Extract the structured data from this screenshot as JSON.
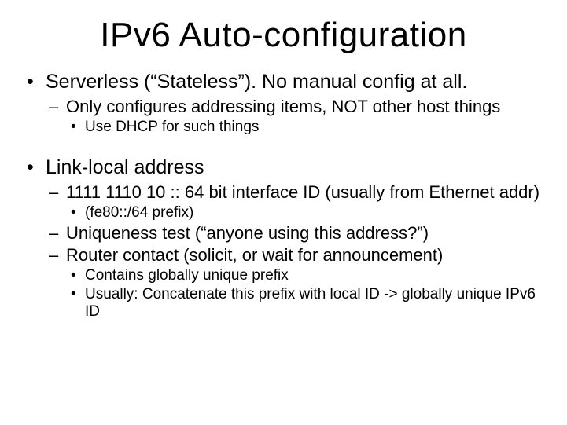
{
  "title": "IPv6 Auto-configuration",
  "bullets": [
    {
      "text": "Serverless (“Stateless”).  No manual config at all.",
      "sub": [
        {
          "text": "Only configures addressing items, NOT other host things",
          "sub": [
            {
              "text": "Use DHCP for such things"
            }
          ]
        }
      ]
    },
    {
      "text": "Link-local address",
      "sub": [
        {
          "text": "1111 1110 10  :: 64 bit interface ID  (usually from Ethernet addr)",
          "sub": [
            {
              "text": "(fe80::/64 prefix)"
            }
          ]
        },
        {
          "text": "Uniqueness test (“anyone using this address?”)"
        },
        {
          "text": "Router contact (solicit, or wait for announcement)",
          "sub": [
            {
              "text": "Contains globally unique prefix"
            },
            {
              "text": "Usually: Concatenate this prefix with local ID -> globally unique IPv6 ID"
            }
          ]
        }
      ]
    }
  ]
}
